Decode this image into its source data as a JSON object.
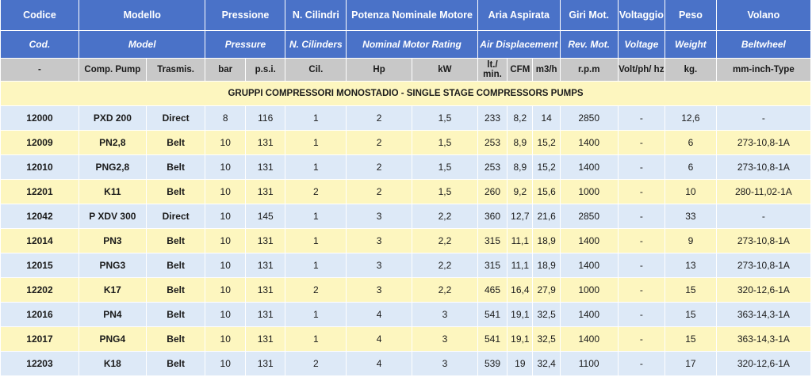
{
  "header_it": {
    "codice": "Codice",
    "modello": "Modello",
    "pressione": "Pressione",
    "cilindri": "N. Cilindri",
    "potenza": "Potenza Nominale Motore",
    "aria": "Aria Aspirata",
    "giri": "Giri Mot.",
    "voltaggio": "Voltaggio",
    "peso": "Peso",
    "volano": "Volano"
  },
  "header_en": {
    "cod": "Cod.",
    "model": "Model",
    "pressure": "Pressure",
    "cylinders": "N. Cilinders",
    "rating": "Nominal Motor Rating",
    "air": "Air Displacement",
    "rev": "Rev. Mot.",
    "voltage": "Voltage",
    "weight": "Weight",
    "beltwheel": "Beltwheel"
  },
  "header_units": [
    "-",
    "Comp. Pump",
    "Trasmis.",
    "bar",
    "p.s.i.",
    "Cil.",
    "Hp",
    "kW",
    "lt./ min.",
    "CFM",
    "m3/h",
    "r.p.m",
    "Volt/ph/ hz",
    "kg.",
    "mm-inch-Type"
  ],
  "section_title": "GRUPPI COMPRESSORI MONOSTADIO - SINGLE STAGE COMPRESSORS PUMPS",
  "rows": [
    [
      "12000",
      "PXD 200",
      "Direct",
      "8",
      "116",
      "1",
      "2",
      "1,5",
      "233",
      "8,2",
      "14",
      "2850",
      "-",
      "12,6",
      "-"
    ],
    [
      "12009",
      "PN2,8",
      "Belt",
      "10",
      "131",
      "1",
      "2",
      "1,5",
      "253",
      "8,9",
      "15,2",
      "1400",
      "-",
      "6",
      "273-10,8-1A"
    ],
    [
      "12010",
      "PNG2,8",
      "Belt",
      "10",
      "131",
      "1",
      "2",
      "1,5",
      "253",
      "8,9",
      "15,2",
      "1400",
      "-",
      "6",
      "273-10,8-1A"
    ],
    [
      "12201",
      "K11",
      "Belt",
      "10",
      "131",
      "2",
      "2",
      "1,5",
      "260",
      "9,2",
      "15,6",
      "1000",
      "-",
      "10",
      "280-11,02-1A"
    ],
    [
      "12042",
      "P XDV 300",
      "Direct",
      "10",
      "145",
      "1",
      "3",
      "2,2",
      "360",
      "12,7",
      "21,6",
      "2850",
      "-",
      "33",
      "-"
    ],
    [
      "12014",
      "PN3",
      "Belt",
      "10",
      "131",
      "1",
      "3",
      "2,2",
      "315",
      "11,1",
      "18,9",
      "1400",
      "-",
      "9",
      "273-10,8-1A"
    ],
    [
      "12015",
      "PNG3",
      "Belt",
      "10",
      "131",
      "1",
      "3",
      "2,2",
      "315",
      "11,1",
      "18,9",
      "1400",
      "-",
      "13",
      "273-10,8-1A"
    ],
    [
      "12202",
      "K17",
      "Belt",
      "10",
      "131",
      "2",
      "3",
      "2,2",
      "465",
      "16,4",
      "27,9",
      "1000",
      "-",
      "15",
      "320-12,6-1A"
    ],
    [
      "12016",
      "PN4",
      "Belt",
      "10",
      "131",
      "1",
      "4",
      "3",
      "541",
      "19,1",
      "32,5",
      "1400",
      "-",
      "15",
      "363-14,3-1A"
    ],
    [
      "12017",
      "PNG4",
      "Belt",
      "10",
      "131",
      "1",
      "4",
      "3",
      "541",
      "19,1",
      "32,5",
      "1400",
      "-",
      "15",
      "363-14,3-1A"
    ],
    [
      "12203",
      "K18",
      "Belt",
      "10",
      "131",
      "2",
      "4",
      "3",
      "539",
      "19",
      "32,4",
      "1100",
      "-",
      "17",
      "320-12,6-1A"
    ]
  ],
  "colors": {
    "header_blue": "#4a72c8",
    "unit_gray": "#c8c8c8",
    "row_blue": "#dde9f7",
    "row_yellow": "#fdf6bf"
  }
}
